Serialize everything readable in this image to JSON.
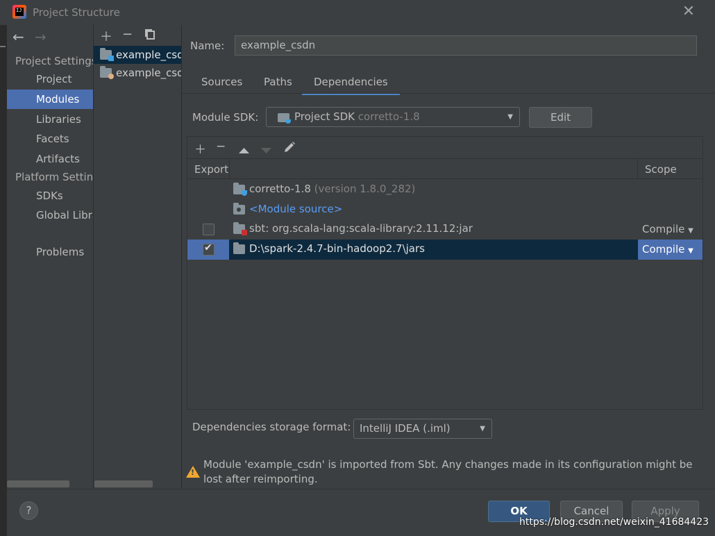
{
  "window": {
    "title": "Project Structure",
    "close_glyph": "✕",
    "app_icon": "intellij-icon"
  },
  "nav": {
    "back_glyph": "←",
    "forward_glyph": "→",
    "section_project": "Project Settings",
    "items_project": [
      "Project",
      "Modules",
      "Libraries",
      "Facets",
      "Artifacts"
    ],
    "section_platform": "Platform Settings",
    "items_platform": [
      "SDKs",
      "Global Libraries"
    ],
    "problems": "Problems",
    "selected": "Modules"
  },
  "module_list": {
    "toolbar": [
      "add-icon",
      "remove-icon",
      "copy-icon"
    ],
    "modules": [
      "example_csdn",
      "example_csdn"
    ]
  },
  "form": {
    "name_label": "Name:",
    "name_value": "example_csdn",
    "tabs": [
      "Sources",
      "Paths",
      "Dependencies"
    ],
    "active_tab": "Dependencies",
    "sdk_label": "Module SDK:",
    "sdk_value": "Project SDK",
    "sdk_detail": "corretto-1.8",
    "edit_label": "Edit"
  },
  "deps": {
    "toolbar": [
      "add-icon",
      "remove-icon",
      "move-up-icon",
      "move-down-icon",
      "edit-icon"
    ],
    "header_export": "Export",
    "header_scope": "Scope",
    "rows": [
      {
        "name": "corretto-1.8",
        "detail": "(version 1.8.0_282)",
        "checkbox": false,
        "scope": ""
      },
      {
        "name": "<Module source>",
        "detail": "",
        "checkbox": false,
        "scope": ""
      },
      {
        "name": "sbt: org.scala-lang:scala-library:2.11.12:jar",
        "detail": "",
        "checkbox": true,
        "checked": false,
        "scope": "Compile"
      },
      {
        "name": "D:\\spark-2.4.7-bin-hadoop2.7\\jars",
        "detail": "",
        "checkbox": true,
        "checked": true,
        "scope": "Compile"
      }
    ],
    "scope_arrow": "▼"
  },
  "storage": {
    "label": "Dependencies storage format:",
    "value": "IntelliJ IDEA (.iml)"
  },
  "warning": {
    "text": "Module 'example_csdn' is imported from Sbt. Any changes made in its configuration might be lost after reimporting."
  },
  "buttons": {
    "help": "?",
    "ok": "OK",
    "cancel": "Cancel",
    "apply": "Apply"
  },
  "watermark": "https://blog.csdn.net/weixin_41684423",
  "colors": {
    "background": "#3c3f41",
    "selection": "#4b6eaf",
    "accent_link": "#589df6",
    "warning": "#f0a732"
  }
}
